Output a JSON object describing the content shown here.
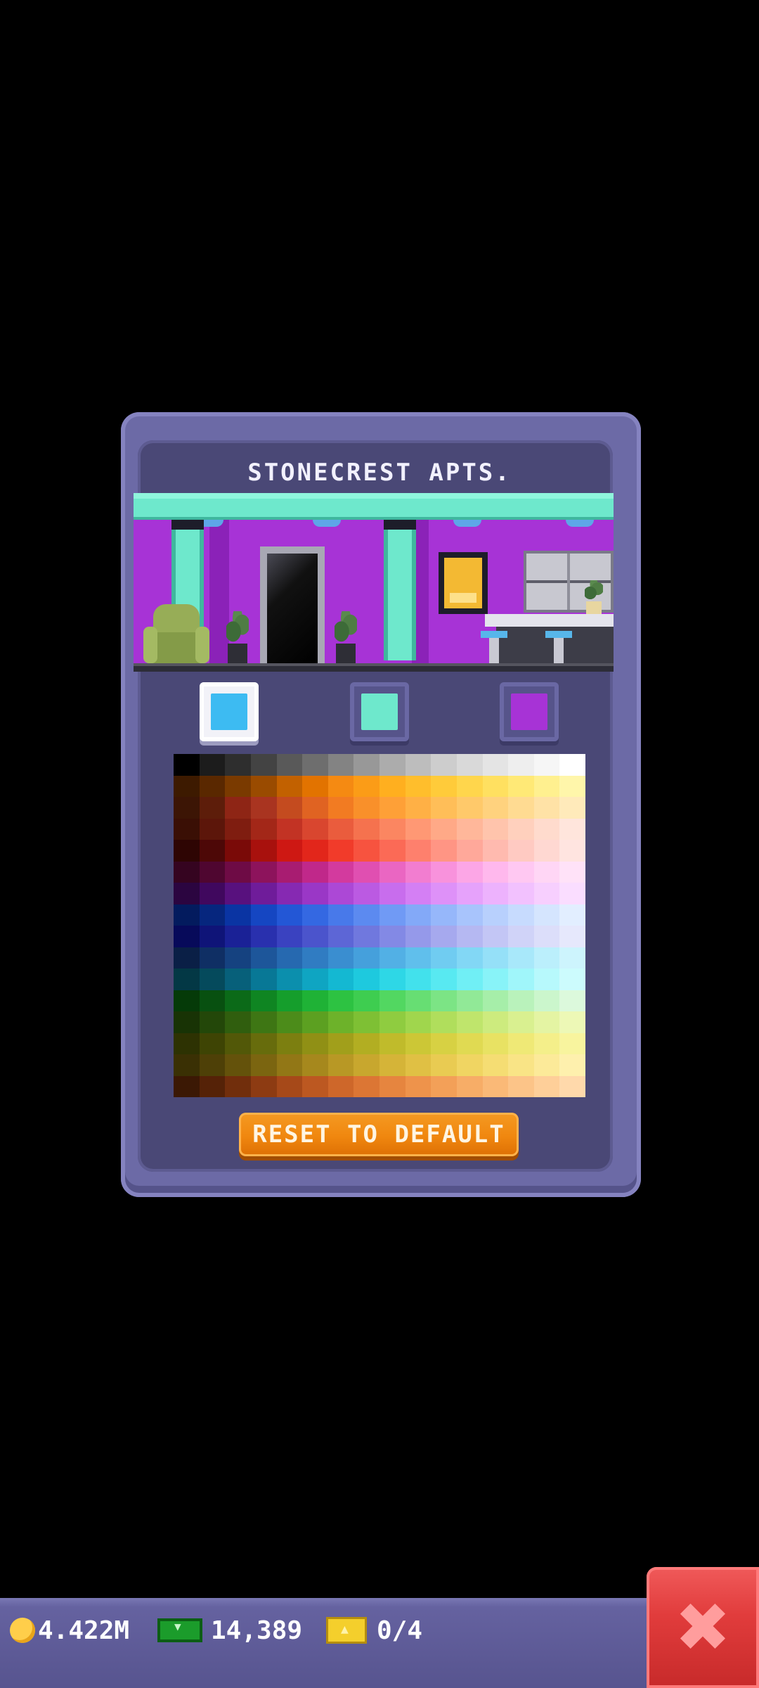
{
  "dialog": {
    "title": "STONECREST APTS.",
    "reset_label": "RESET TO DEFAULT"
  },
  "swatches": [
    {
      "color": "#3dbbf2",
      "selected": true
    },
    {
      "color": "#6ee8cc",
      "selected": false
    },
    {
      "color": "#a733d6",
      "selected": false
    }
  ],
  "palette": [
    [
      "#000000",
      "#1c1c1c",
      "#2e2e2e",
      "#434343",
      "#595959",
      "#6e6e6e",
      "#838383",
      "#989898",
      "#acacac",
      "#bdbdbd",
      "#cdcdcd",
      "#d9d9d9",
      "#e4e4e4",
      "#eeeeee",
      "#f6f6f6",
      "#ffffff"
    ],
    [
      "#3d1a00",
      "#5a2800",
      "#7a3a00",
      "#9a4b00",
      "#c26100",
      "#e27300",
      "#f58a12",
      "#fb9c17",
      "#ffaf1f",
      "#ffbe2c",
      "#ffcb3a",
      "#ffd64c",
      "#ffe060",
      "#ffe976",
      "#fff08f",
      "#fff6aa"
    ],
    [
      "#3c1505",
      "#5d1d0a",
      "#8e2515",
      "#a93420",
      "#c44b1f",
      "#e06322",
      "#f27b22",
      "#f9902a",
      "#fea037",
      "#ffb045",
      "#ffbe58",
      "#ffc96a",
      "#ffd27e",
      "#ffdb92",
      "#ffe2a6",
      "#ffeaba"
    ],
    [
      "#3a0f05",
      "#5c160a",
      "#7f1d10",
      "#a32718",
      "#c23324",
      "#d9462f",
      "#ea5c3d",
      "#f5724e",
      "#fb8661",
      "#ff9874",
      "#ffa987",
      "#ffb79a",
      "#ffc4ac",
      "#ffd0bd",
      "#ffdbcd",
      "#ffe5dc"
    ],
    [
      "#2e0503",
      "#4d0807",
      "#7a0a08",
      "#a8110d",
      "#ce1813",
      "#e2261b",
      "#f13b2a",
      "#f7533f",
      "#fb6a56",
      "#fe806d",
      "#ff9584",
      "#ffa89a",
      "#ffbaaf",
      "#ffcac2",
      "#ffd8d2",
      "#ffe4e0"
    ],
    [
      "#350420",
      "#4f0630",
      "#6e0b45",
      "#8d135c",
      "#a81c71",
      "#c0288a",
      "#d33a9e",
      "#e04fb1",
      "#ea66c2",
      "#f27dd0",
      "#f892dc",
      "#fca6e6",
      "#ffb8ed",
      "#ffc8f2",
      "#ffd6f5",
      "#ffe2f8"
    ],
    [
      "#2b0540",
      "#40085e",
      "#58117e",
      "#6f1c9a",
      "#8629b2",
      "#9a37c6",
      "#ac48d6",
      "#bb5ae2",
      "#c86ded",
      "#d47ff4",
      "#de91f8",
      "#e6a2fb",
      "#edb2fd",
      "#f2c1fe",
      "#f7cffe",
      "#faddff"
    ],
    [
      "#031b5e",
      "#06267e",
      "#0a34a3",
      "#1546c2",
      "#2357d6",
      "#3468e2",
      "#4879ea",
      "#5c8af0",
      "#709af5",
      "#83a9f8",
      "#96b7fa",
      "#a8c4fc",
      "#b8d0fd",
      "#c7dbfe",
      "#d5e5fe",
      "#e2eeff"
    ],
    [
      "#070a5a",
      "#0f1478",
      "#1a2196",
      "#2930ae",
      "#3a42c0",
      "#4b54cc",
      "#5d66d6",
      "#7078de",
      "#8389e5",
      "#9599ea",
      "#a6a9ee",
      "#b5b8f2",
      "#c3c6f5",
      "#d0d3f8",
      "#dcdefa",
      "#e6e8fc"
    ],
    [
      "#0a1f46",
      "#0f2f64",
      "#154280",
      "#1d569a",
      "#2669b0",
      "#307cc2",
      "#3a8ed0",
      "#45a0dc",
      "#52b0e5",
      "#60bfec",
      "#70ccf1",
      "#82d7f5",
      "#95e0f8",
      "#a8e8fa",
      "#bbeffc",
      "#cdf4fd"
    ],
    [
      "#033845",
      "#054a5c",
      "#07607a",
      "#087896",
      "#0b8fad",
      "#0fa5c2",
      "#14b8d2",
      "#1ec9de",
      "#2ed7e6",
      "#42e1ec",
      "#58e9f1",
      "#70eff5",
      "#88f3f8",
      "#a0f6fa",
      "#b7f9fc",
      "#ccfbfd"
    ],
    [
      "#053a08",
      "#085010",
      "#0b6a18",
      "#0f8522",
      "#159e2c",
      "#1fb236",
      "#2dc242",
      "#3ecd50",
      "#52d761",
      "#67de73",
      "#7ce485",
      "#91e997",
      "#a6eea9",
      "#b9f2bb",
      "#cbf6cc",
      "#dcf9dc"
    ],
    [
      "#183305",
      "#234709",
      "#305e0e",
      "#3e7614",
      "#4c8c1a",
      "#5ca021",
      "#6db22a",
      "#7ec034",
      "#8fcc40",
      "#a0d64d",
      "#b0de5c",
      "#bfe56c",
      "#cdeb7e",
      "#d9f090",
      "#e4f4a3",
      "#edf8b6"
    ],
    [
      "#2d3202",
      "#3e4404",
      "#525808",
      "#676c0c",
      "#7c7f10",
      "#909015",
      "#a19f1b",
      "#b2ae22",
      "#c0bb2b",
      "#ccc736",
      "#d7d143",
      "#e0da52",
      "#e8e263",
      "#efe976",
      "#f4ef8a",
      "#f8f49e"
    ],
    [
      "#3a3004",
      "#4e4007",
      "#64520b",
      "#7b6510",
      "#927716",
      "#a6881d",
      "#b89825",
      "#c8a72e",
      "#d5b438",
      "#e0c044",
      "#e9cb52",
      "#f0d562",
      "#f5dd73",
      "#f9e486",
      "#fcea99",
      "#fef0ad"
    ],
    [
      "#3b1804",
      "#552207",
      "#712e0c",
      "#8d3b12",
      "#a64919",
      "#bc5821",
      "#ce672a",
      "#dc7634",
      "#e6853f",
      "#ee934b",
      "#f3a058",
      "#f7ad67",
      "#fab977",
      "#fcc488",
      "#fecf99",
      "#ffd9ab"
    ]
  ],
  "bottom_bar": {
    "coins": "4.422M",
    "cash": "14,389",
    "tickets": "0/4",
    "colors": {
      "bar": "#57548f",
      "close": "#e13c3c"
    }
  },
  "icons": {
    "coin": "coin-icon",
    "cash": "cash-icon",
    "ticket": "ticket-icon",
    "close": "close-icon"
  }
}
